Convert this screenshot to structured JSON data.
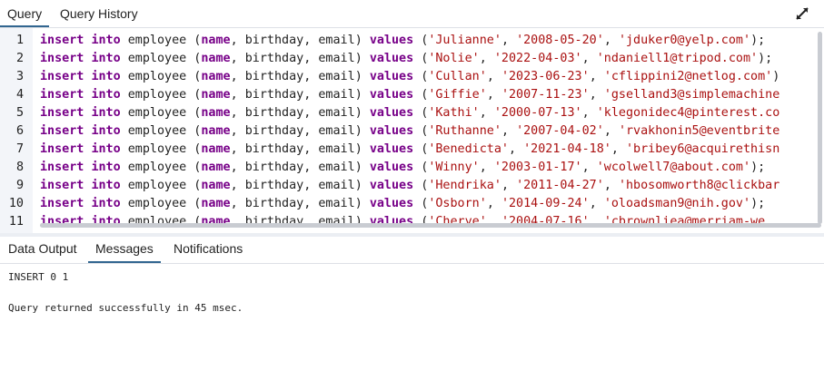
{
  "top_tabs": {
    "query": "Query",
    "query_history": "Query History"
  },
  "editor": {
    "lines": [
      {
        "num": "1",
        "table": "employee",
        "cols": [
          "name",
          "birthday",
          "email"
        ],
        "vals": [
          "'Julianne'",
          "'2008-05-20'",
          "'jduker0@yelp.com'"
        ],
        "end": ");"
      },
      {
        "num": "2",
        "table": "employee",
        "cols": [
          "name",
          "birthday",
          "email"
        ],
        "vals": [
          "'Nolie'",
          "'2022-04-03'",
          "'ndaniell1@tripod.com'"
        ],
        "end": ");"
      },
      {
        "num": "3",
        "table": "employee",
        "cols": [
          "name",
          "birthday",
          "email"
        ],
        "vals": [
          "'Cullan'",
          "'2023-06-23'",
          "'cflippini2@netlog.com'"
        ],
        "end": ")"
      },
      {
        "num": "4",
        "table": "employee",
        "cols": [
          "name",
          "birthday",
          "email"
        ],
        "vals": [
          "'Giffie'",
          "'2007-11-23'",
          "'gselland3@simplemachine"
        ],
        "end": ""
      },
      {
        "num": "5",
        "table": "employee",
        "cols": [
          "name",
          "birthday",
          "email"
        ],
        "vals": [
          "'Kathi'",
          "'2000-07-13'",
          "'klegonidec4@pinterest.co"
        ],
        "end": ""
      },
      {
        "num": "6",
        "table": "employee",
        "cols": [
          "name",
          "birthday",
          "email"
        ],
        "vals": [
          "'Ruthanne'",
          "'2007-04-02'",
          "'rvakhonin5@eventbrite"
        ],
        "end": ""
      },
      {
        "num": "7",
        "table": "employee",
        "cols": [
          "name",
          "birthday",
          "email"
        ],
        "vals": [
          "'Benedicta'",
          "'2021-04-18'",
          "'bribey6@acquirethisn"
        ],
        "end": ""
      },
      {
        "num": "8",
        "table": "employee",
        "cols": [
          "name",
          "birthday",
          "email"
        ],
        "vals": [
          "'Winny'",
          "'2003-01-17'",
          "'wcolwell7@about.com'"
        ],
        "end": ");"
      },
      {
        "num": "9",
        "table": "employee",
        "cols": [
          "name",
          "birthday",
          "email"
        ],
        "vals": [
          "'Hendrika'",
          "'2011-04-27'",
          "'hbosomworth8@clickbar"
        ],
        "end": ""
      },
      {
        "num": "10",
        "table": "employee",
        "cols": [
          "name",
          "birthday",
          "email"
        ],
        "vals": [
          "'Osborn'",
          "'2014-09-24'",
          "'oloadsman9@nih.gov'"
        ],
        "end": ");"
      },
      {
        "num": "11",
        "table": "employee",
        "cols": [
          "name",
          "birthday",
          "email"
        ],
        "vals": [
          "'Cherye'",
          "'2004-07-16'",
          "'cbrownliea@merriam-we"
        ],
        "end": ""
      }
    ],
    "keywords": {
      "insert": "insert",
      "into": "into",
      "values": "values"
    }
  },
  "bottom_tabs": {
    "data_output": "Data Output",
    "messages": "Messages",
    "notifications": "Notifications"
  },
  "messages": {
    "line1": "INSERT 0 1",
    "line2": "Query returned successfully in 45 msec."
  }
}
